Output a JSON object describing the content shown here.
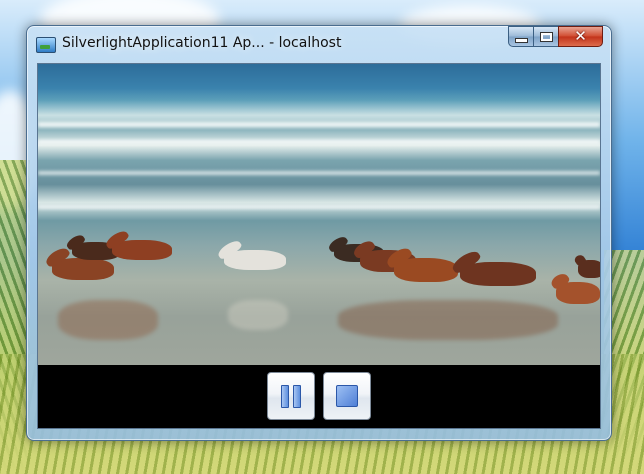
{
  "window": {
    "title": "SilverlightApplication11 Ap... - localhost",
    "icon": "silverlight-app-icon",
    "caption_buttons": [
      "minimize",
      "maximize",
      "close"
    ]
  },
  "video": {
    "description_icon": "video-frame"
  },
  "controls": {
    "pause_icon": "pause-icon",
    "stop_icon": "stop-icon"
  },
  "colors": {
    "close_button": "#c2321a",
    "control_glyph": "#4f7fd6",
    "control_bar": "#000000"
  }
}
